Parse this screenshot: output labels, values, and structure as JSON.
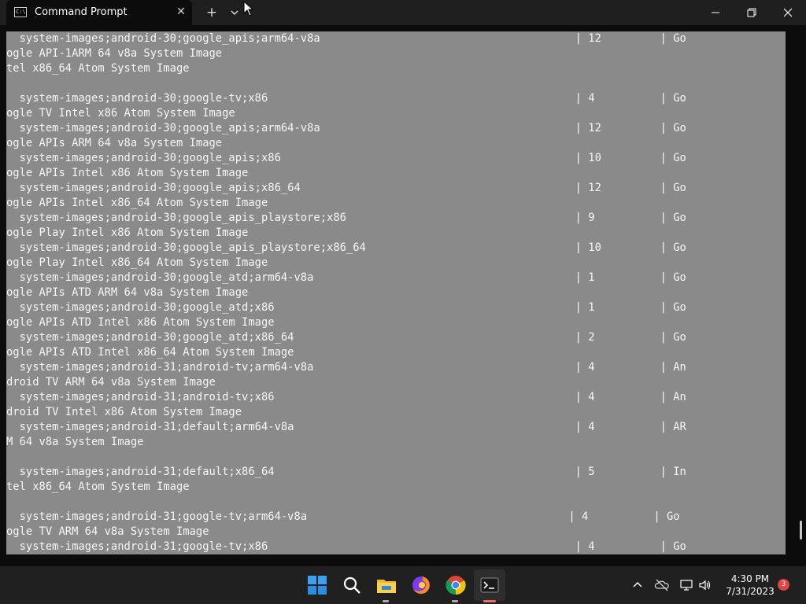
{
  "window": {
    "tab_title": "Command Prompt",
    "tab_icon_text": "C:\\"
  },
  "terminal": {
    "lines": [
      "  system-images;android-30;google_apis;arm64-v8a                                       | 12         | Go",
      "ogle API-1ARM 64 v8a System Image",
      "tel x86_64 Atom System Image",
      "",
      "  system-images;android-30;google-tv;x86                                               | 4          | Go",
      "ogle TV Intel x86 Atom System Image",
      "  system-images;android-30;google_apis;arm64-v8a                                       | 12         | Go",
      "ogle APIs ARM 64 v8a System Image",
      "  system-images;android-30;google_apis;x86                                             | 10         | Go",
      "ogle APIs Intel x86 Atom System Image",
      "  system-images;android-30;google_apis;x86_64                                          | 12         | Go",
      "ogle APIs Intel x86_64 Atom System Image",
      "  system-images;android-30;google_apis_playstore;x86                                   | 9          | Go",
      "ogle Play Intel x86 Atom System Image",
      "  system-images;android-30;google_apis_playstore;x86_64                                | 10         | Go",
      "ogle Play Intel x86_64 Atom System Image",
      "  system-images;android-30;google_atd;arm64-v8a                                        | 1          | Go",
      "ogle APIs ATD ARM 64 v8a System Image",
      "  system-images;android-30;google_atd;x86                                              | 1          | Go",
      "ogle APIs ATD Intel x86 Atom System Image",
      "  system-images;android-30;google_atd;x86_64                                           | 2          | Go",
      "ogle APIs ATD Intel x86_64 Atom System Image",
      "  system-images;android-31;android-tv;arm64-v8a                                        | 4          | An",
      "droid TV ARM 64 v8a System Image",
      "  system-images;android-31;android-tv;x86                                              | 4          | An",
      "droid TV Intel x86 Atom System Image",
      "  system-images;android-31;default;arm64-v8a                                           | 4          | AR",
      "M 64 v8a System Image",
      "",
      "  system-images;android-31;default;x86_64                                              | 5          | In",
      "tel x86_64 Atom System Image",
      "",
      "  system-images;android-31;google-tv;arm64-v8a                                        | 4          | Go",
      "ogle TV ARM 64 v8a System Image",
      "  system-images;android-31;google-tv;x86                                               | 4          | Go"
    ]
  },
  "taskbar": {
    "apps": [
      "start-icon",
      "search-icon",
      "file-explorer-icon",
      "firefox-icon",
      "chrome-icon",
      "terminal-icon"
    ],
    "clock_time": "4:30 PM",
    "clock_date": "7/31/2023",
    "notification_count": "3"
  },
  "colors": {
    "selection": "#8a8a8a",
    "terminal_bg": "#0c0c0c",
    "titlebar_bg": "#1f1f1f",
    "taskbar_bg": "#202020"
  }
}
